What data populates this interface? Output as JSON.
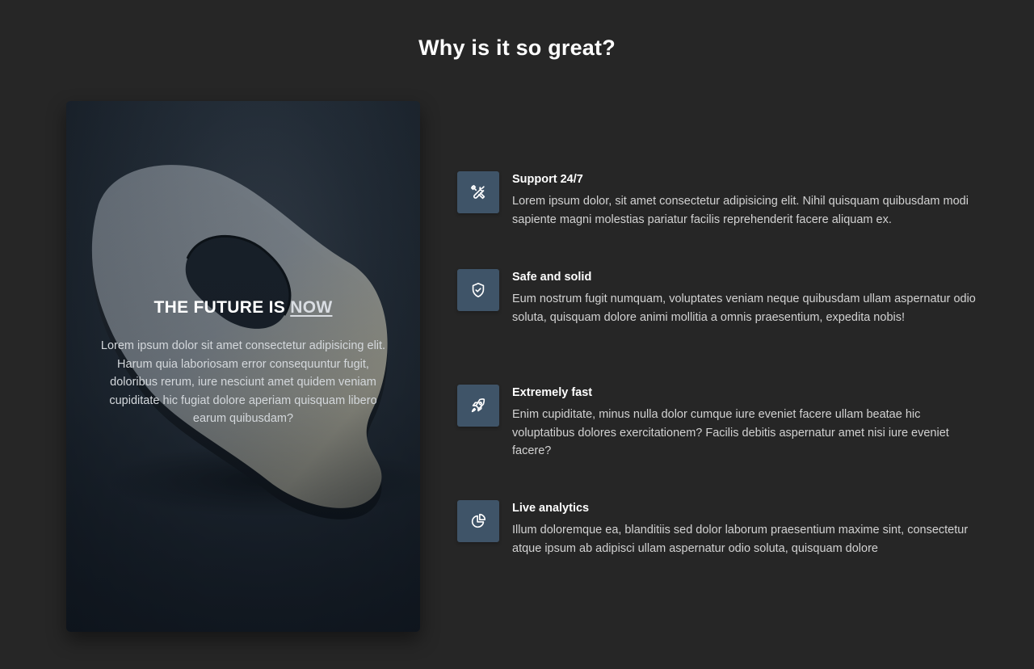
{
  "section": {
    "title": "Why is it so great?"
  },
  "hero": {
    "heading_prefix": "THE FUTURE IS ",
    "heading_link": "NOW",
    "text": "Lorem ipsum dolor sit amet consectetur adipisicing elit. Harum quia laboriosam error consequuntur fugit, doloribus rerum, iure nesciunt amet quidem veniam cupiditate hic fugiat dolore aperiam quisquam libero earum quibusdam?"
  },
  "features": [
    {
      "icon": "tools-icon",
      "title": "Support 24/7",
      "text": "Lorem ipsum dolor, sit amet consectetur adipisicing elit. Nihil quisquam quibusdam modi sapiente magni molestias pariatur facilis reprehenderit facere aliquam ex."
    },
    {
      "icon": "shield-check-icon",
      "title": "Safe and solid",
      "text": "Eum nostrum fugit numquam, voluptates veniam neque quibusdam ullam aspernatur odio soluta, quisquam dolore animi mollitia a omnis praesentium, expedita nobis!"
    },
    {
      "icon": "rocket-icon",
      "title": "Extremely fast",
      "text": "Enim cupiditate, minus nulla dolor cumque iure eveniet facere ullam beatae hic voluptatibus dolores exercitationem? Facilis debitis aspernatur amet nisi iure eveniet facere?"
    },
    {
      "icon": "pie-chart-icon",
      "title": "Live analytics",
      "text": "Illum doloremque ea, blanditiis sed dolor laborum praesentium maxime sint, consectetur atque ipsum ab adipisci ullam aspernatur odio soluta, quisquam dolore"
    }
  ],
  "colors": {
    "background": "#262626",
    "icon_tile": "#3f5468",
    "text_muted": "#d2d2d2"
  }
}
